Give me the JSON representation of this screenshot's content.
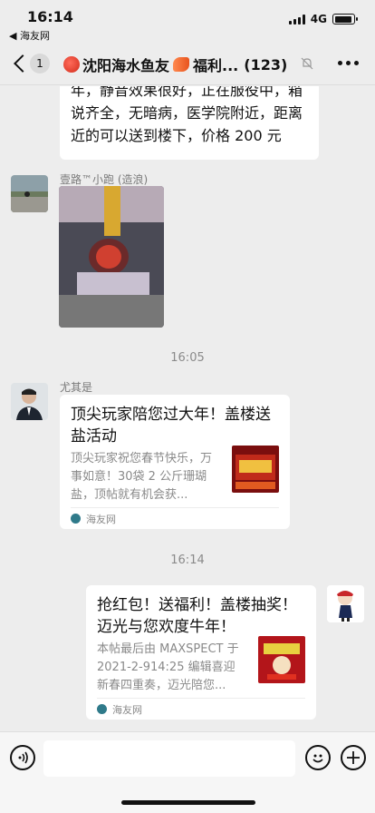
{
  "status_bar": {
    "time": "16:14",
    "back_app": "◀ 海友网",
    "network": "4G",
    "battery_level": 0.9
  },
  "nav": {
    "back_count": "1",
    "title_part1": "沈阳海水鱼友",
    "title_part2": "福利...",
    "member_count": "(123)"
  },
  "messages": {
    "top_text": "年，静音效果很好，正在服役中，箱说齐全，无暗病，医学院附近，距离近的可以送到楼下，价格 200 元",
    "sender1": "壹路™小跑 (造浪)",
    "time1": "16:05",
    "sender2": "尤其是",
    "card1": {
      "title": "顶尖玩家陪您过大年！盖楼送盐活动",
      "desc": "顶尖玩家祝您春节快乐，万事如意！30袋 2 公斤珊瑚盐，顶帖就有机会获...",
      "source": "海友网"
    },
    "time2": "16:14",
    "card2": {
      "title": "抢红包！送福利！盖楼抽奖！迈光与您欢度牛年！",
      "desc": "本帖最后由 MAXSPECT 于 2021-2-914:25 编辑喜迎新春四重奏，迈光陪您...",
      "source": "海友网"
    }
  }
}
